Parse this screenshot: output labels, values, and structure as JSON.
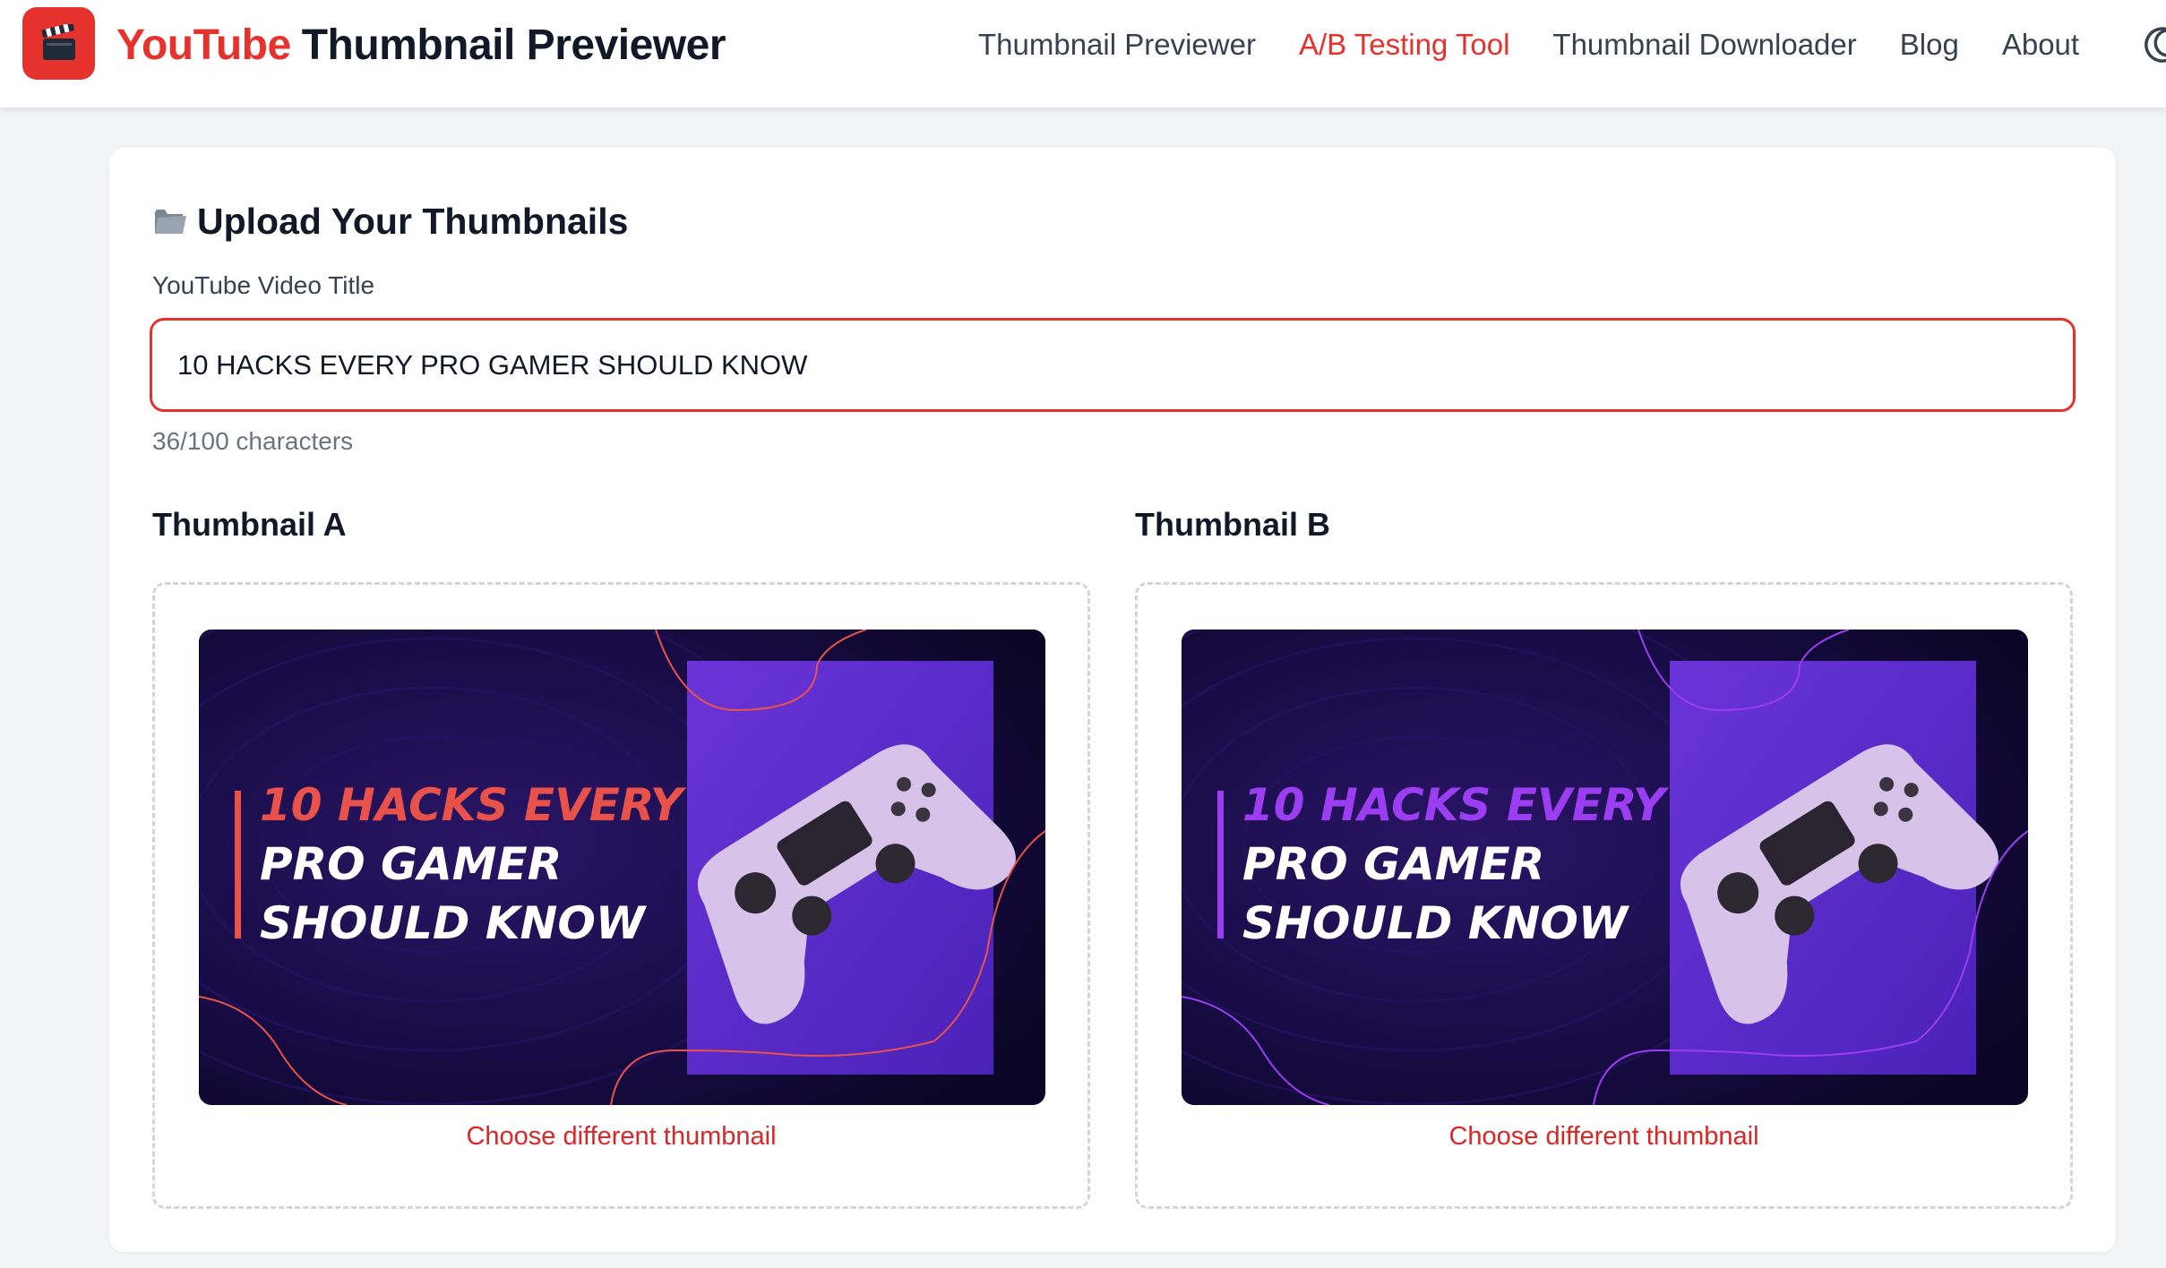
{
  "header": {
    "brand_red": "YouTube",
    "brand_dark": "Thumbnail Previewer",
    "logo_icon": "clapperboard-icon",
    "nav": [
      {
        "label": "Thumbnail Previewer",
        "active": false
      },
      {
        "label": "A/B Testing Tool",
        "active": true
      },
      {
        "label": "Thumbnail Downloader",
        "active": false
      },
      {
        "label": "Blog",
        "active": false
      },
      {
        "label": "About",
        "active": false
      }
    ],
    "theme_toggle_icon": "moon-icon"
  },
  "upload": {
    "section_icon": "folder-icon",
    "section_title": "Upload Your Thumbnails",
    "title_label": "YouTube Video Title",
    "title_value": "10 HACKS EVERY PRO GAMER SHOULD KNOW",
    "char_count": "36/100 characters"
  },
  "thumbnails": [
    {
      "heading": "Thumbnail A",
      "lines": [
        "10 HACKS EVERY",
        "PRO GAMER",
        "SHOULD KNOW"
      ],
      "accent": "#e8524a",
      "choose_label": "Choose different thumbnail"
    },
    {
      "heading": "Thumbnail B",
      "lines": [
        "10 HACKS EVERY",
        "PRO GAMER",
        "SHOULD KNOW"
      ],
      "accent": "#9b3df0",
      "choose_label": "Choose different thumbnail"
    }
  ],
  "colors": {
    "brand": "#e5322d",
    "link": "#dc2626",
    "thumb_bg": "#120a36",
    "thumb_panel": "#5b2bd0"
  }
}
